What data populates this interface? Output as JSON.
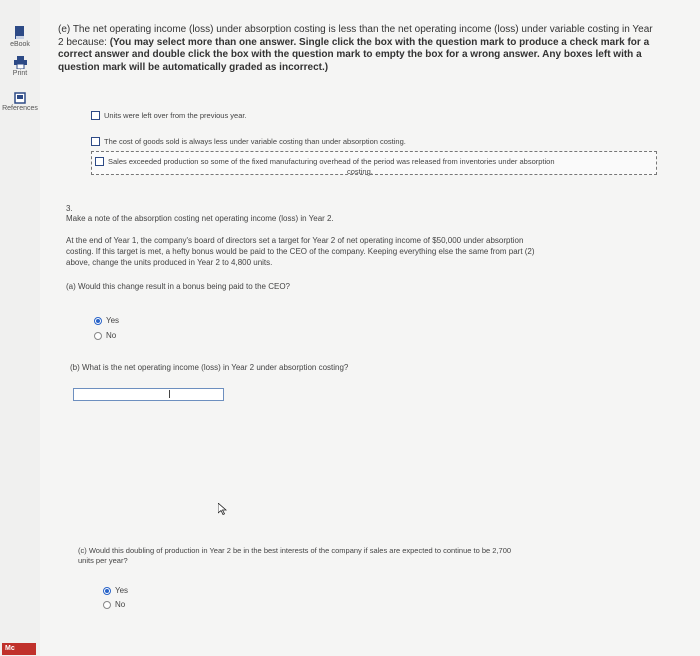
{
  "sidebar": {
    "ebook_label": "eBook",
    "print_label": "Print",
    "references_label": "References",
    "logo_text": "Mc"
  },
  "part_e": {
    "line1": "(e) The net operating income (loss) under absorption costing is less than the net operating income (loss) under variable costing in Year",
    "line2_plain": "2 because: ",
    "line2_bold": "(You may select more than one answer. Single click the box with the question mark to produce a check mark for a",
    "line3_bold": "correct answer and double click the box with the question mark to empty the box for a wrong answer. Any boxes left with a",
    "line4_bold": "question mark will be automatically graded as incorrect.)",
    "options": [
      "Units were left over from the previous year.",
      "The cost of goods sold is always less under variable costing than under absorption costing.",
      "Sales exceeded production so some of the fixed manufacturing overhead of the period was released from inventories under absorption",
      "costing."
    ]
  },
  "q3": {
    "number": "3.",
    "instruction": "Make a note of the absorption costing net operating income (loss) in Year 2.",
    "para1": "At the end of Year 1, the company's board of directors set a target for Year 2 of net operating income of $50,000 under absorption",
    "para2": "costing. If this target is met, a hefty bonus would be paid to the CEO of the company. Keeping everything else the same from part (2)",
    "para3": "above, change the units produced in Year 2 to 4,800 units.",
    "part_a": "(a) Would this change result in a bonus being paid to the CEO?",
    "part_a_yes": "Yes",
    "part_a_no": "No",
    "part_b": "(b) What is the net operating income (loss) in Year 2 under absorption costing?",
    "part_b_value": "",
    "part_c1": "(c) Would this doubling of production in Year 2 be in the best interests of the company if sales are expected to continue to be 2,700",
    "part_c2": "units per year?",
    "part_c_yes": "Yes",
    "part_c_no": "No"
  }
}
